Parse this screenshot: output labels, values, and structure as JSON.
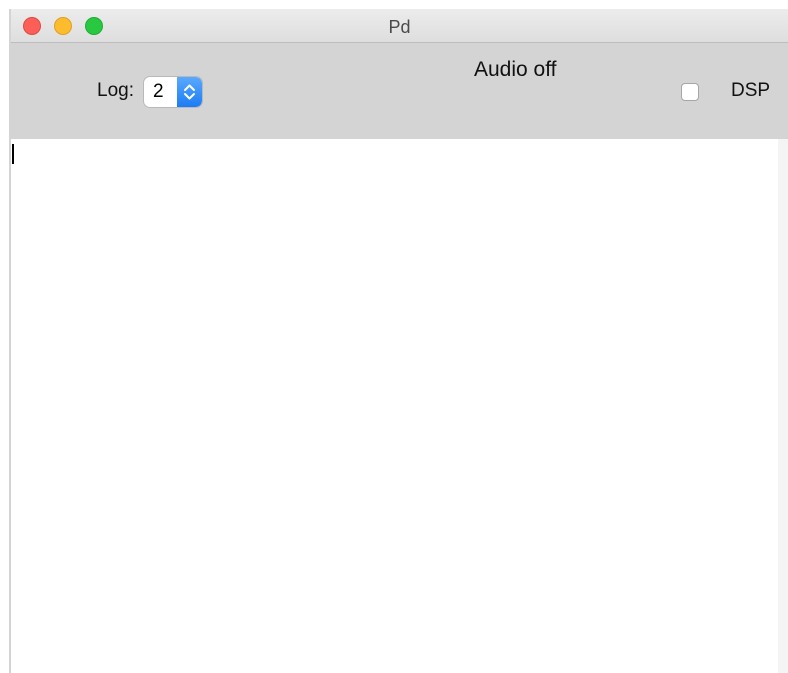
{
  "window": {
    "title": "Pd"
  },
  "toolbar": {
    "log_label": "Log:",
    "log_value": "2",
    "audio_status": "Audio off",
    "dsp_label": "DSP",
    "dsp_checked": false
  },
  "colors": {
    "toolbar_bg": "#d4d4d4",
    "stepper_accent": "#1c7cf4",
    "close": "#fd5f58",
    "minimize": "#fdbb2e",
    "maximize": "#28c840"
  },
  "console": {
    "text": ""
  }
}
